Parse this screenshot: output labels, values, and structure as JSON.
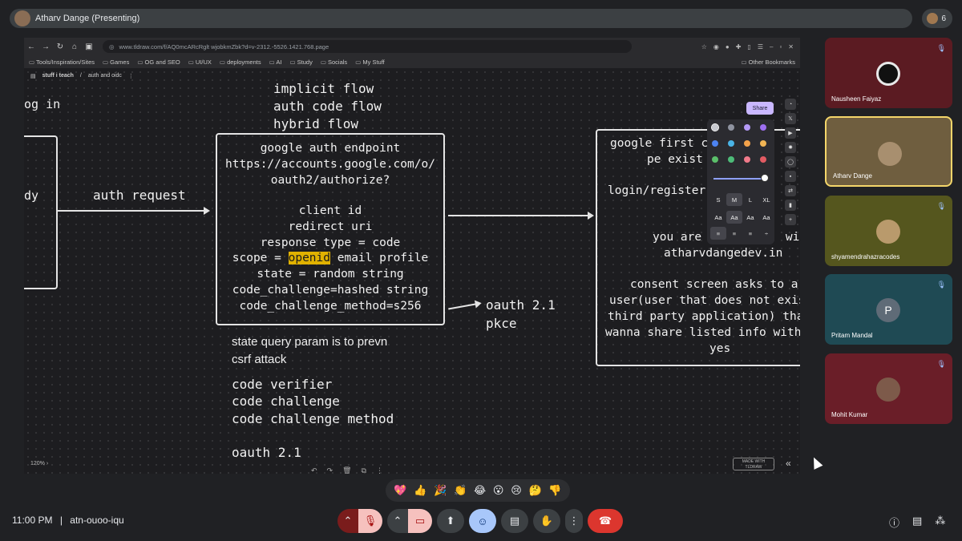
{
  "meet": {
    "presenter_label": "Atharv Dange (Presenting)",
    "participant_count": "6",
    "time": "11:00 PM",
    "separator": "|",
    "meeting_code": "atn-ouoo-iqu"
  },
  "browser": {
    "url": "www.tldraw.com/f/AQ0mcARcRglt wjobkmZbk?d=v-2312.-5526.1421.768.page",
    "bookmarks": [
      "Tools/Inspiration/Sites",
      "Games",
      "OG and SEO",
      "UI/UX",
      "deployments",
      "AI",
      "Study",
      "Socials",
      "My Stuff"
    ],
    "other_bookmarks": "Other Bookmarks"
  },
  "tldraw": {
    "breadcrumb_root": "stuff i teach",
    "breadcrumb_sep": "/",
    "breadcrumb_page": "auth and oidc",
    "share_label": "Share",
    "zoom": "120%",
    "made_with": "MADE WITH",
    "brand": "TLDRAW",
    "sizes": [
      "S",
      "M",
      "L",
      "XL"
    ],
    "font_samples": [
      "Aa",
      "Aa",
      "Aa",
      "Aa"
    ],
    "colors": [
      "#c7c9d0",
      "#8f93a0",
      "#b59af7",
      "#9d6ff0",
      "#4d83f0",
      "#4ab4e6",
      "#f3a24a",
      "#f0b454",
      "#5bbf6a",
      "#4dbb78",
      "#f07a8a",
      "#e25b63"
    ]
  },
  "canvas": {
    "left_cut": "og in",
    "left_cut2": "dy",
    "flows": [
      "implicit flow",
      "auth code flow",
      "hybrid flow"
    ],
    "arrow_label": "auth request",
    "center_box": {
      "l1": "google auth endpoint",
      "l2": "https://accounts.google.com/o/",
      "l3": "oauth2/authorize?",
      "l4": "client id",
      "l5": "redirect uri",
      "l6": "response type = code",
      "l7a": "scope = ",
      "l7b": "openid",
      "l7c": " email profile",
      "l8": "state = random string",
      "l9": "code_challenge=hashed string",
      "l10": "code_challenge_method=s256"
    },
    "oauth_pkce": [
      "oauth 2.1",
      "pkce"
    ],
    "right_box": {
      "l1": "google first chec",
      "l2": "pe exist ka",
      "l3": "login/register scr",
      "l4": "you are loggin in  wi",
      "l5": "atharvdangedev.in",
      "l6": "consent screen asks to a",
      "l7": "user(user that does not exis",
      "l8": "third party application) tha",
      "l9": "wanna share listed info with",
      "l10": "yes"
    },
    "typed_line1": "state query param is to prevn",
    "typed_line2": "csrf attack",
    "code_terms": [
      "code verifier",
      "code challenge",
      "code challenge method"
    ],
    "bottom_label": "oauth 2.1"
  },
  "participants": [
    {
      "name": "Nausheen Faiyaz",
      "bg": "#5b1b22"
    },
    {
      "name": "Atharv Dange",
      "bg": "#6f5e3f"
    },
    {
      "name": "shyamendrahazracodes",
      "bg": "#55561e"
    },
    {
      "name": "Pritam Mandal",
      "bg": "#1f4a54",
      "initial": "P"
    },
    {
      "name": "Mohit Kumar",
      "bg": "#6a1e28"
    }
  ],
  "reactions": [
    "💖",
    "👍",
    "🎉",
    "👏",
    "😂",
    "😮",
    "😢",
    "🤔",
    "👎"
  ]
}
